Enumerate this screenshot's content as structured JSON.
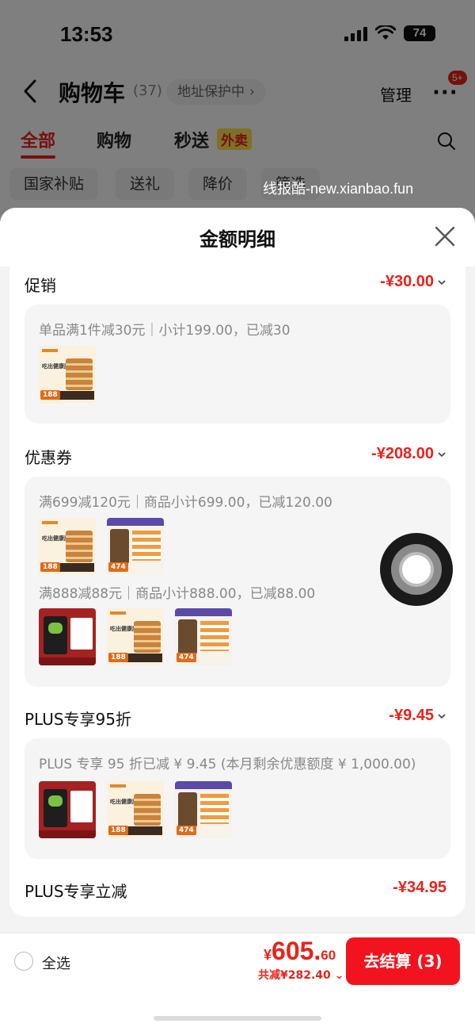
{
  "status": {
    "time": "13:53",
    "battery": "74"
  },
  "nav": {
    "title": "购物车",
    "count": "(37)",
    "address_chip": "地址保护中",
    "manage": "管理",
    "more_badge": "5+"
  },
  "tabs": {
    "all": "全部",
    "shopping": "购物",
    "express": "秒送",
    "express_badge": "外卖"
  },
  "filters": [
    "国家补贴",
    "送礼",
    "降价",
    "筛选"
  ],
  "watermark": "线报酷-new.xianbao.fun",
  "sheet": {
    "title": "金额明细",
    "promotion": {
      "title": "促销",
      "amount": "-¥30.00",
      "note": "单品满1件减30元｜小计199.00，已减30"
    },
    "coupon": {
      "title": "优惠券",
      "amount": "-¥208.00",
      "note1": "满699减120元｜商品小计699.00，已减120.00",
      "note2": "满888减88元｜商品小计888.00，已减88.00"
    },
    "plus_discount": {
      "title": "PLUS专享95折",
      "amount": "-¥9.45",
      "note": "PLUS 专享 95 折已减 ¥ 9.45 (本月剩余优惠额度 ¥ 1,000.00)"
    },
    "plus_instant": {
      "title": "PLUS专享立减",
      "amount": "-¥34.95"
    }
  },
  "thumbs": {
    "price_can": "188",
    "price_kibble": "474",
    "can_text": "吃出健康肥长肉补水"
  },
  "bottom": {
    "select_all": "全选",
    "currency": "¥",
    "total_int": "605.",
    "total_dec": "60",
    "saved": "共减¥282.40",
    "checkout": "去结算 (3)"
  },
  "colors": {
    "accent": "#e8231a",
    "checkout": "#f3131f"
  }
}
